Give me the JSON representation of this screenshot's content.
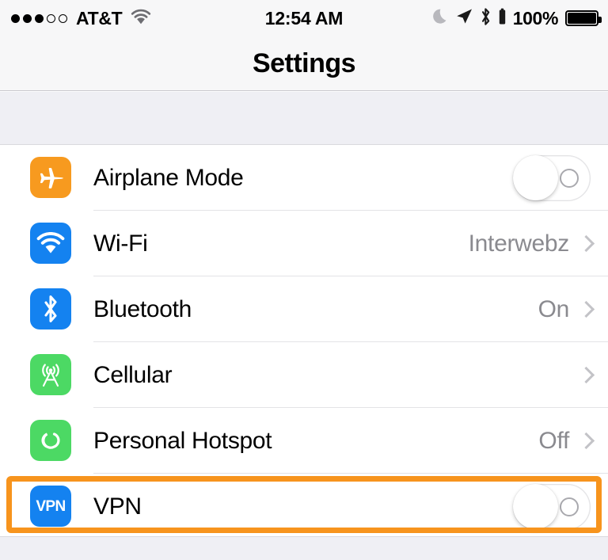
{
  "status_bar": {
    "signal_dots_filled": 3,
    "signal_dots_total": 5,
    "carrier": "AT&T",
    "wifi_icon": "wifi-icon",
    "time": "12:54 AM",
    "do_not_disturb_icon": "moon-icon",
    "location_icon": "location-arrow-icon",
    "bluetooth_icon": "bluetooth-icon",
    "battery_percent": "100%",
    "battery_level": 100
  },
  "nav": {
    "title": "Settings"
  },
  "colors": {
    "airplane_icon_bg": "#F79A1F",
    "wifi_icon_bg": "#1482F0",
    "bluetooth_icon_bg": "#1482F0",
    "cellular_icon_bg": "#4CD964",
    "hotspot_icon_bg": "#4CD964",
    "vpn_icon_bg": "#1482F0",
    "highlight": "#F7941D",
    "value_text": "#8A8A8F",
    "chevron": "#C3C3C7",
    "group_background": "#EFEFF4"
  },
  "rows": [
    {
      "id": "airplane-mode",
      "label": "Airplane Mode",
      "icon": "airplane-icon",
      "accessory": "toggle",
      "toggle_on": false,
      "value": ""
    },
    {
      "id": "wifi",
      "label": "Wi-Fi",
      "icon": "wifi-icon",
      "accessory": "disclosure",
      "value": "Interwebz"
    },
    {
      "id": "bluetooth",
      "label": "Bluetooth",
      "icon": "bluetooth-icon",
      "accessory": "disclosure",
      "value": "On"
    },
    {
      "id": "cellular",
      "label": "Cellular",
      "icon": "cell-tower-icon",
      "accessory": "disclosure",
      "value": ""
    },
    {
      "id": "personal-hotspot",
      "label": "Personal Hotspot",
      "icon": "hotspot-link-icon",
      "accessory": "disclosure",
      "value": "Off"
    },
    {
      "id": "vpn",
      "label": "VPN",
      "icon": "vpn-icon",
      "icon_text": "VPN",
      "accessory": "toggle",
      "toggle_on": false,
      "value": "",
      "highlighted": true
    }
  ]
}
